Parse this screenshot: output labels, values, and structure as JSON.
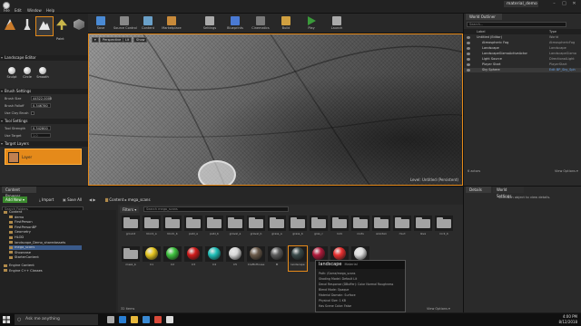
{
  "window": {
    "tab_title": "material_demo",
    "menus": [
      "File",
      "Edit",
      "Window",
      "Help"
    ],
    "controls": [
      "–",
      "□",
      "✕"
    ]
  },
  "modes": [
    {
      "id": "place",
      "label": ""
    },
    {
      "id": "paint",
      "label": ""
    },
    {
      "id": "landscape",
      "label": ""
    },
    {
      "id": "foliage",
      "label": ""
    },
    {
      "id": "geometry",
      "label": "Paint"
    }
  ],
  "toolbar": {
    "buttons": [
      "Save",
      "Source Control",
      "Content",
      "Marketplace",
      "Settings",
      "Blueprints",
      "Cinematics",
      "Build",
      "Play",
      "Launch"
    ]
  },
  "left_panel": {
    "title": "Landscape Editor",
    "brush_settings_title": "Brush Settings",
    "brush_size_label": "Brush Size",
    "brush_size_value": "44522.0000",
    "brush_falloff_label": "Brush Falloff",
    "brush_falloff_value": "0.346780",
    "use_clay_label": "Use Clay Brush",
    "tool_settings_title": "Tool Settings",
    "tool_strength_label": "Tool Strength",
    "tool_strength_value": "0.342800",
    "use_target_label": "Use Target",
    "use_target_value": "1.0",
    "target_layers_title": "Target Layers",
    "tools": [
      {
        "label": "Sculpt",
        "color": "#c5c5c5"
      },
      {
        "label": "Circle",
        "color": "#c5c5c5"
      },
      {
        "label": "Smooth",
        "color": "#c5c5c5"
      }
    ],
    "layer_name": "Layer"
  },
  "viewport": {
    "buttons": [
      "▾",
      "Perspective",
      "Lit",
      "Show"
    ],
    "status": "Level: Untitled (Persistent)"
  },
  "outliner": {
    "tab": "World Outliner",
    "search_placeholder": "Search...",
    "col_label": "Label",
    "col_type": "Type",
    "rows": [
      {
        "label": "Untitled (Editor)",
        "type": "World"
      },
      {
        "label": "Atmospheric Fog",
        "type": "AtmosphericFog"
      },
      {
        "label": "Landscape",
        "type": "Landscape"
      },
      {
        "label": "LandscapeGizmoActiveActor",
        "type": "LandscapeGizmo"
      },
      {
        "label": "Light Source",
        "type": "DirectionalLight"
      },
      {
        "label": "Player Start",
        "type": "PlayerStart"
      },
      {
        "label": "Sky Sphere",
        "type": "Edit BP_Sky_Sph"
      }
    ],
    "actor_count": "6 actors",
    "view_options": "View Options ▾"
  },
  "details": {
    "tab": "Details",
    "tab2": "World Settings",
    "search_placeholder": "",
    "empty_text": "Select an object to view details."
  },
  "content_browser": {
    "tab": "Content Browser",
    "add_new": "Add New ▾",
    "import": "Import",
    "save_all": "Save All",
    "path": [
      "Content",
      "mega_scans"
    ],
    "filters": "Filters ▾",
    "search_placeholder": "Search mega_scans",
    "tree": [
      {
        "label": "Content",
        "indent": 0
      },
      {
        "label": "demo",
        "indent": 1
      },
      {
        "label": "FirstPerson",
        "indent": 1
      },
      {
        "label": "FirstPersonBP",
        "indent": 1
      },
      {
        "label": "Geometry",
        "indent": 1
      },
      {
        "label": "HLOD",
        "indent": 1
      },
      {
        "label": "landscape_Demo_sharedassets",
        "indent": 1
      },
      {
        "label": "mega_scans",
        "indent": 1
      },
      {
        "label": "Showcase",
        "indent": 1
      },
      {
        "label": "StarterContent",
        "indent": 1
      },
      {
        "label": "Engine Content",
        "indent": 0
      },
      {
        "label": "Engine C++ Classes",
        "indent": 0
      }
    ],
    "folders": [
      "ground",
      "block_a",
      "block_b",
      "pebl_a",
      "pebl_b",
      "gravel_a",
      "gravel_b",
      "grass_a",
      "grass_b",
      "gras_c",
      "rock",
      "roots",
      "wooden",
      "mud",
      "lava",
      "rock_b"
    ],
    "assets": [
      {
        "name": "mask_b",
        "kind": "folder",
        "color": ""
      },
      {
        "name": "C1",
        "kind": "ball",
        "color": "#e8c820"
      },
      {
        "name": "C2",
        "kind": "ball",
        "color": "#3ec23e"
      },
      {
        "name": "C3",
        "kind": "ball",
        "color": "#d01a1a"
      },
      {
        "name": "C4",
        "kind": "ball",
        "color": "#1fbfb8"
      },
      {
        "name": "C5",
        "kind": "ball",
        "color": "#d8d8d8"
      },
      {
        "name": "CraftoHouse",
        "kind": "ball",
        "color": "#6a5a4a"
      },
      {
        "name": "M",
        "kind": "ball",
        "color": "#5a5a5a"
      },
      {
        "name": "landscape",
        "kind": "ball",
        "color": "#3a4a4a"
      },
      {
        "name": "",
        "kind": "ball",
        "color": "#b01a3a"
      },
      {
        "name": "",
        "kind": "ball",
        "color": "#ea3030"
      },
      {
        "name": "",
        "kind": "ball",
        "color": "#dddddd"
      }
    ],
    "item_count": "32 items",
    "view_options": "View Options ▾"
  },
  "tooltip": {
    "title": "landscape",
    "subtitle": "Material",
    "rows": [
      "Path: /Game/mega_scans",
      "Shading Model: Default Lit",
      "Decal Response (DBuffer): Color Normal Roughness",
      "Blend Mode: Opaque",
      "Material Domain: Surface",
      "Physical Size: 1 KB",
      "Has Scene Color: False"
    ]
  },
  "taskbar": {
    "search_text": "Ask me anything",
    "time": "4:00 PM",
    "date": "8/12/2018",
    "icons": [
      {
        "name": "task-view-icon",
        "color": "#aaaaaa"
      },
      {
        "name": "edge-icon",
        "color": "#2a7fd4"
      },
      {
        "name": "explorer-icon",
        "color": "#e8b93c"
      },
      {
        "name": "store-icon",
        "color": "#3a8ad4"
      },
      {
        "name": "chrome-icon",
        "color": "#d94a3a"
      },
      {
        "name": "unreal-icon",
        "color": "#dddddd"
      }
    ]
  }
}
